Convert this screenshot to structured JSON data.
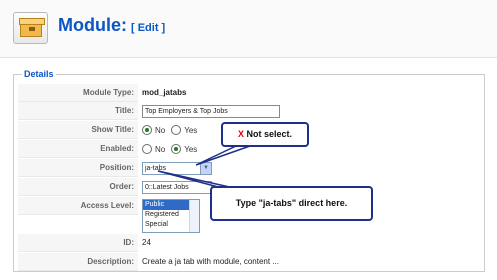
{
  "header": {
    "icon": "module-box-icon",
    "title": "Module:",
    "edit": "[ Edit ]"
  },
  "details": {
    "legend": "Details",
    "module_type": {
      "label": "Module Type:",
      "value": "mod_jatabs"
    },
    "title": {
      "label": "Title:",
      "value": "Top Employers & Top Jobs"
    },
    "show_title": {
      "label": "Show Title:",
      "no": "No",
      "yes": "Yes",
      "selected": "No"
    },
    "enabled": {
      "label": "Enabled:",
      "no": "No",
      "yes": "Yes",
      "selected": "Yes"
    },
    "position": {
      "label": "Position:",
      "value": "ja-tabs"
    },
    "order": {
      "label": "Order:",
      "value": "0::Latest Jobs"
    },
    "access_level": {
      "label": "Access Level:",
      "options": [
        "Public",
        "Registered",
        "Special"
      ],
      "selected": "Public"
    },
    "id": {
      "label": "ID:",
      "value": "24"
    },
    "description": {
      "label": "Description:",
      "value": "Create a ja tab with module, content ..."
    }
  },
  "callouts": {
    "not_select_mark": "X",
    "not_select_text": "Not select.",
    "type_direct": "Type \"ja-tabs\" direct here."
  },
  "colors": {
    "accent": "#0b55c4",
    "callout_border": "#1f2f8a",
    "warning": "#e20000"
  }
}
